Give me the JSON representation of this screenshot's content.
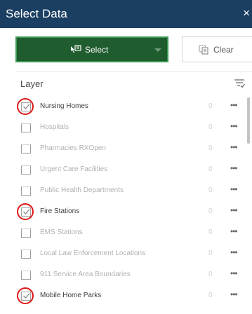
{
  "header": {
    "title": "Select Data",
    "close_glyph": "×"
  },
  "toolbar": {
    "select_label": "Select",
    "select_icon": "select-icon",
    "clear_label": "Clear",
    "clear_icon": "clear-selection-icon"
  },
  "layer_header": {
    "label": "Layer",
    "filter_icon": "filter-icon"
  },
  "colors": {
    "header_bg": "#1b3f63",
    "select_bg": "#1f5c2e",
    "select_border": "#3c9a55",
    "highlight_ring": "#e11616"
  },
  "layers": [
    {
      "name": "Nursing Homes",
      "count": "0",
      "checked": true,
      "highlighted": true
    },
    {
      "name": "Hospitals",
      "count": "0",
      "checked": false,
      "highlighted": false
    },
    {
      "name": "Pharmacies RXOpen",
      "count": "0",
      "checked": false,
      "highlighted": false
    },
    {
      "name": "Urgent Care Facilities",
      "count": "0",
      "checked": false,
      "highlighted": false
    },
    {
      "name": "Public Health Departments",
      "count": "0",
      "checked": false,
      "highlighted": false
    },
    {
      "name": "Fire Stations",
      "count": "0",
      "checked": true,
      "highlighted": true
    },
    {
      "name": "EMS Stations",
      "count": "0",
      "checked": false,
      "highlighted": false
    },
    {
      "name": "Local Law Enforcement Locations",
      "count": "0",
      "checked": false,
      "highlighted": false
    },
    {
      "name": "911 Service Area Boundaries",
      "count": "0",
      "checked": false,
      "highlighted": false
    },
    {
      "name": "Mobile Home Parks",
      "count": "0",
      "checked": true,
      "highlighted": true
    }
  ],
  "more_glyph": "•••"
}
